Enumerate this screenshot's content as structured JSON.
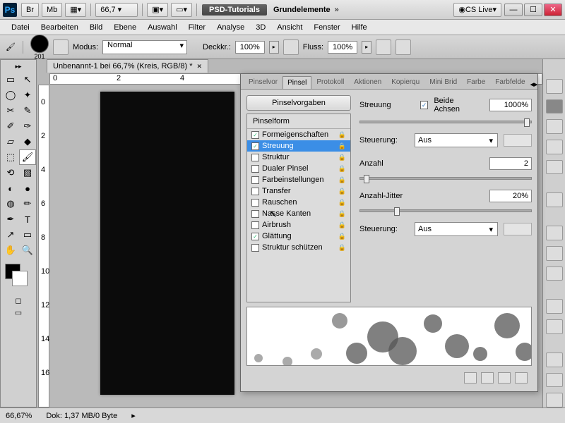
{
  "titlebar": {
    "zoom_value": "66,7",
    "psd_tutorials": "PSD-Tutorials",
    "doc_label": "Grundelemente",
    "cs_live": "CS Live",
    "btn_br": "Br",
    "btn_mb": "Mb"
  },
  "menu": [
    "Datei",
    "Bearbeiten",
    "Bild",
    "Ebene",
    "Auswahl",
    "Filter",
    "Analyse",
    "3D",
    "Ansicht",
    "Fenster",
    "Hilfe"
  ],
  "options": {
    "brush_size": "201",
    "mode_label": "Modus:",
    "mode_value": "Normal",
    "opacity_label": "Deckkr.:",
    "opacity_value": "100%",
    "flow_label": "Fluss:",
    "flow_value": "100%"
  },
  "doc_tab": "Unbenannt-1 bei 66,7% (Kreis, RGB/8) *",
  "ruler_marks_h": [
    "0",
    "2",
    "4"
  ],
  "ruler_marks_v": [
    "0",
    "2",
    "4",
    "6",
    "8",
    "10",
    "12",
    "14",
    "16"
  ],
  "status": {
    "zoom": "66,67%",
    "doc_info": "Dok: 1,37 MB/0 Byte"
  },
  "brush_panel": {
    "tabs": [
      "Pinselvor",
      "Pinsel",
      "Protokoll",
      "Aktionen",
      "Kopierqu",
      "Mini Brid",
      "Farbe",
      "Farbfelde"
    ],
    "active_tab": 1,
    "preset_btn": "Pinselvorgaben",
    "list_head": "Pinselform",
    "items": [
      {
        "label": "Formeigenschaften",
        "checked": true,
        "sel": false
      },
      {
        "label": "Streuung",
        "checked": true,
        "sel": true
      },
      {
        "label": "Struktur",
        "checked": false,
        "sel": false
      },
      {
        "label": "Dualer Pinsel",
        "checked": false,
        "sel": false
      },
      {
        "label": "Farbeinstellungen",
        "checked": false,
        "sel": false
      },
      {
        "label": "Transfer",
        "checked": false,
        "sel": false
      },
      {
        "label": "Rauschen",
        "checked": false,
        "sel": false
      },
      {
        "label": "Nasse Kanten",
        "checked": false,
        "sel": false
      },
      {
        "label": "Airbrush",
        "checked": false,
        "sel": false
      },
      {
        "label": "Glättung",
        "checked": true,
        "sel": false
      },
      {
        "label": "Struktur schützen",
        "checked": false,
        "sel": false
      }
    ],
    "settings": {
      "scatter_label": "Streuung",
      "both_axes_label": "Beide Achsen",
      "both_axes_checked": true,
      "scatter_value": "1000%",
      "control_label": "Steuerung:",
      "control_value": "Aus",
      "count_label": "Anzahl",
      "count_value": "2",
      "count_jitter_label": "Anzahl-Jitter",
      "count_jitter_value": "20%",
      "control2_value": "Aus"
    }
  }
}
